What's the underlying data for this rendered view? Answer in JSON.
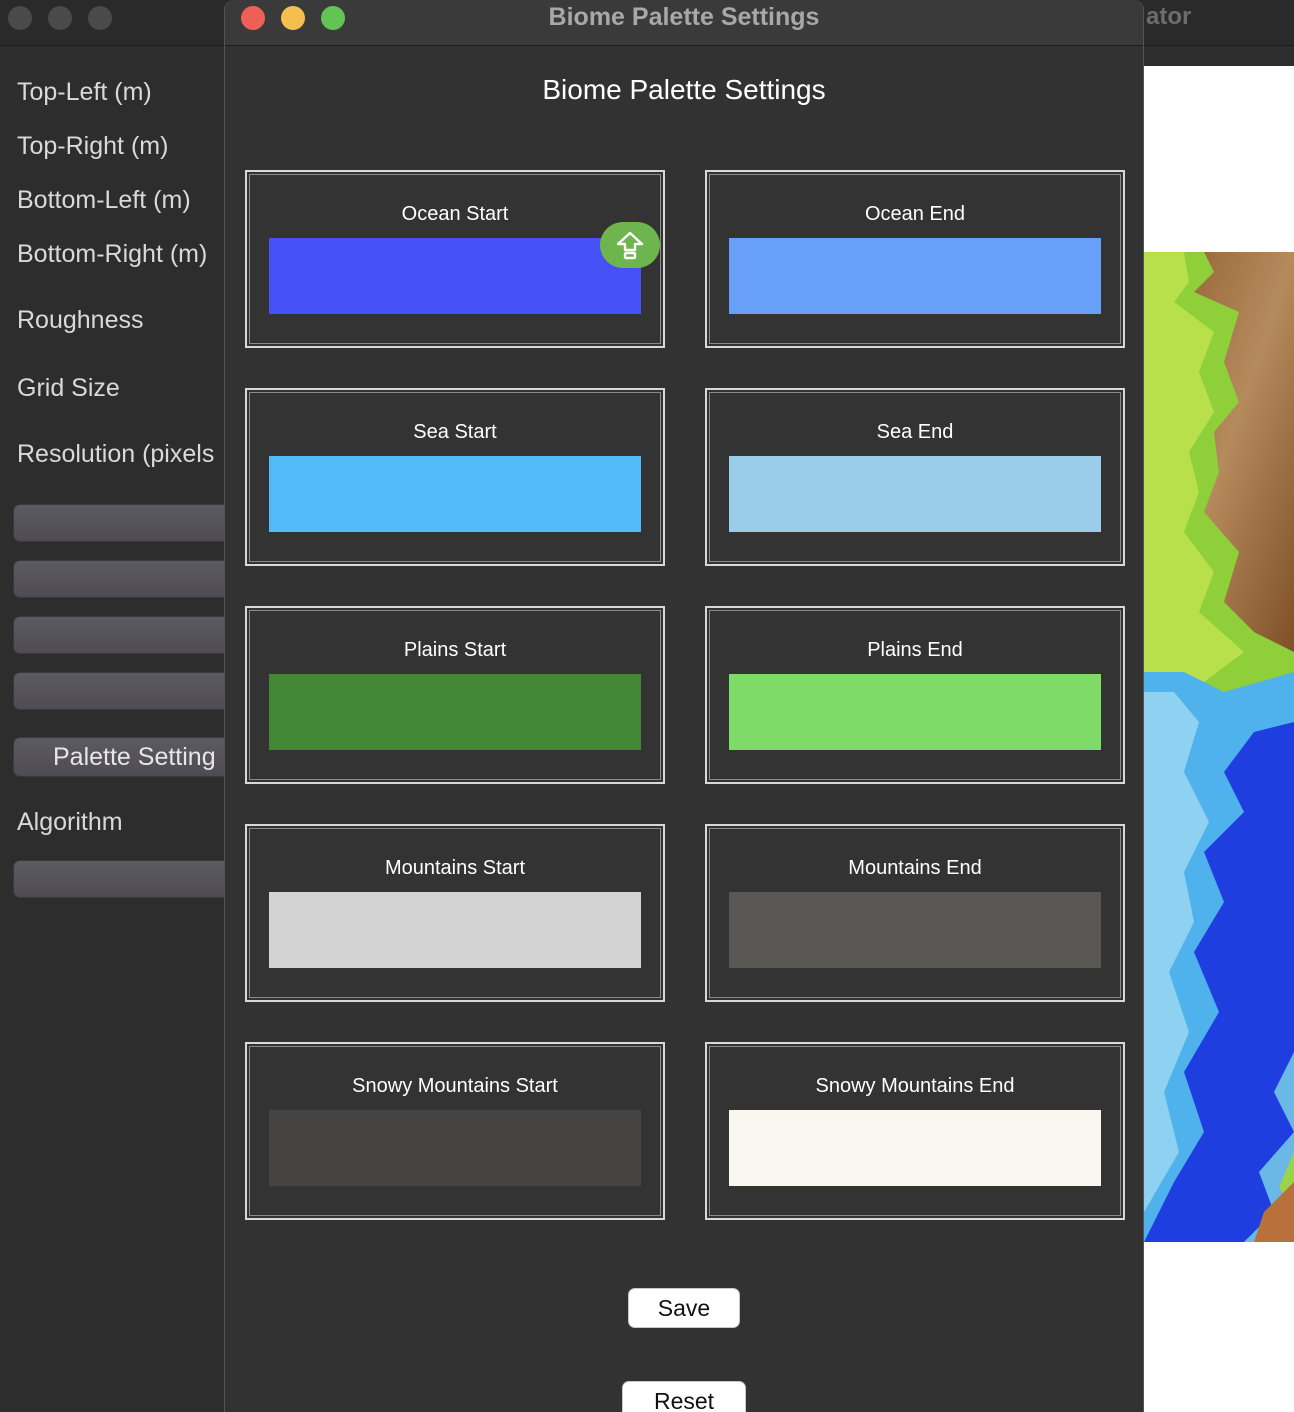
{
  "background_window": {
    "title_fragment": "ator",
    "sidebar_labels": [
      "Top-Left (m)",
      "Top-Right (m)",
      "Bottom-Left (m)",
      "Bottom-Right (m)",
      "Roughness",
      "Grid Size",
      "Resolution (pixels"
    ],
    "palette_button_label": "Palette Setting",
    "algorithm_label": "Algorithm"
  },
  "dialog": {
    "window_title": "Biome Palette Settings",
    "heading": "Biome Palette Settings",
    "swatches": [
      {
        "label": "Ocean Start",
        "color": "#4551f4"
      },
      {
        "label": "Ocean End",
        "color": "#68a0f7"
      },
      {
        "label": "Sea Start",
        "color": "#52bbf7"
      },
      {
        "label": "Sea End",
        "color": "#98cce9"
      },
      {
        "label": "Plains Start",
        "color": "#438634"
      },
      {
        "label": "Plains End",
        "color": "#7edb67"
      },
      {
        "label": "Mountains Start",
        "color": "#d3d3d3"
      },
      {
        "label": "Mountains End",
        "color": "#585753"
      },
      {
        "label": "Snowy Mountains Start",
        "color": "#454442"
      },
      {
        "label": "Snowy Mountains End",
        "color": "#f9f5ef"
      }
    ],
    "save_label": "Save",
    "reset_label": "Reset"
  },
  "colors": {
    "traffic_close": "#ed5f57",
    "traffic_minimize": "#f4bf4f",
    "traffic_zoom": "#61c554",
    "upload_badge": "#6db54c"
  },
  "icons": {
    "upload_badge_icon": "upload-arrow-icon"
  }
}
